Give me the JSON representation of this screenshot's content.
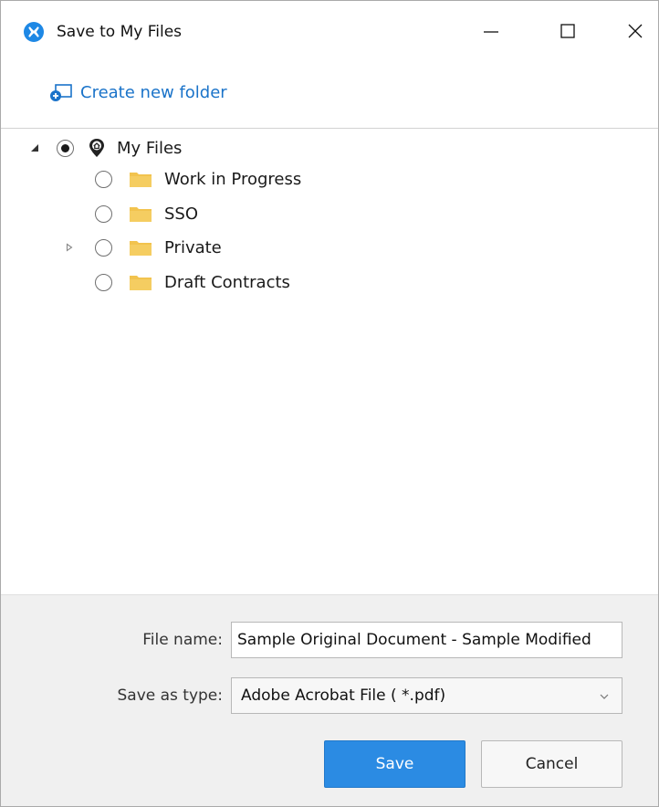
{
  "window": {
    "title": "Save to My Files",
    "icon": "app-logo-icon",
    "accent_color": "#1e88e5"
  },
  "toolbar": {
    "create_folder_label": "Create new folder",
    "create_folder_icon": "new-folder-icon",
    "link_color": "#1a73c9"
  },
  "tree": {
    "root": {
      "label": "My Files",
      "selected": true,
      "expanded": true,
      "icon": "home-pin-icon"
    },
    "children": [
      {
        "label": "Work in Progress",
        "selected": false,
        "has_children": false,
        "icon": "folder-icon"
      },
      {
        "label": "SSO",
        "selected": false,
        "has_children": false,
        "icon": "folder-icon"
      },
      {
        "label": "Private",
        "selected": false,
        "has_children": true,
        "icon": "folder-icon"
      },
      {
        "label": "Draft Contracts",
        "selected": false,
        "has_children": false,
        "icon": "folder-icon"
      }
    ],
    "folder_color": "#f2c34e"
  },
  "form": {
    "file_name_label": "File name:",
    "file_name_value": "Sample Original Document - Sample Modified",
    "save_type_label": "Save as type:",
    "save_type_value": "Adobe Acrobat File ( *.pdf)"
  },
  "buttons": {
    "save_label": "Save",
    "cancel_label": "Cancel",
    "save_color": "#2b8be3"
  }
}
